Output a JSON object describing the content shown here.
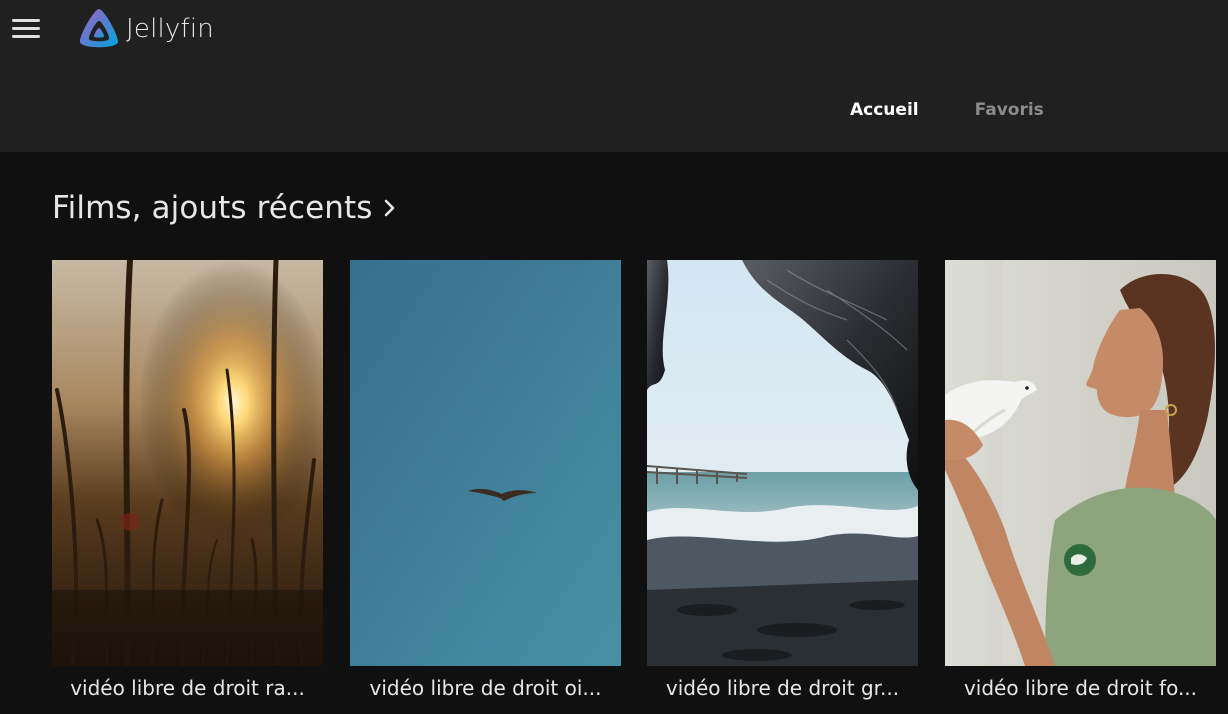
{
  "header": {
    "app_name": "Jellyfin",
    "menu_icon": "hamburger-menu-icon",
    "logo_icon": "jellyfin-logo-icon",
    "tabs": [
      {
        "label": "Accueil",
        "active": true
      },
      {
        "label": "Favoris",
        "active": false
      }
    ]
  },
  "section": {
    "title": "Films, ajouts récents",
    "chevron_icon": "chevron-right-icon"
  },
  "cards": [
    {
      "title": "vidéo libre de droit ra..."
    },
    {
      "title": "vidéo libre de droit oi..."
    },
    {
      "title": "vidéo libre de droit gr..."
    },
    {
      "title": "vidéo libre de droit fo..."
    }
  ],
  "colors": {
    "header_bg": "#202020",
    "page_bg": "#101010",
    "logo_gradient_start": "#aa5cc3",
    "logo_gradient_end": "#00a4dc"
  }
}
